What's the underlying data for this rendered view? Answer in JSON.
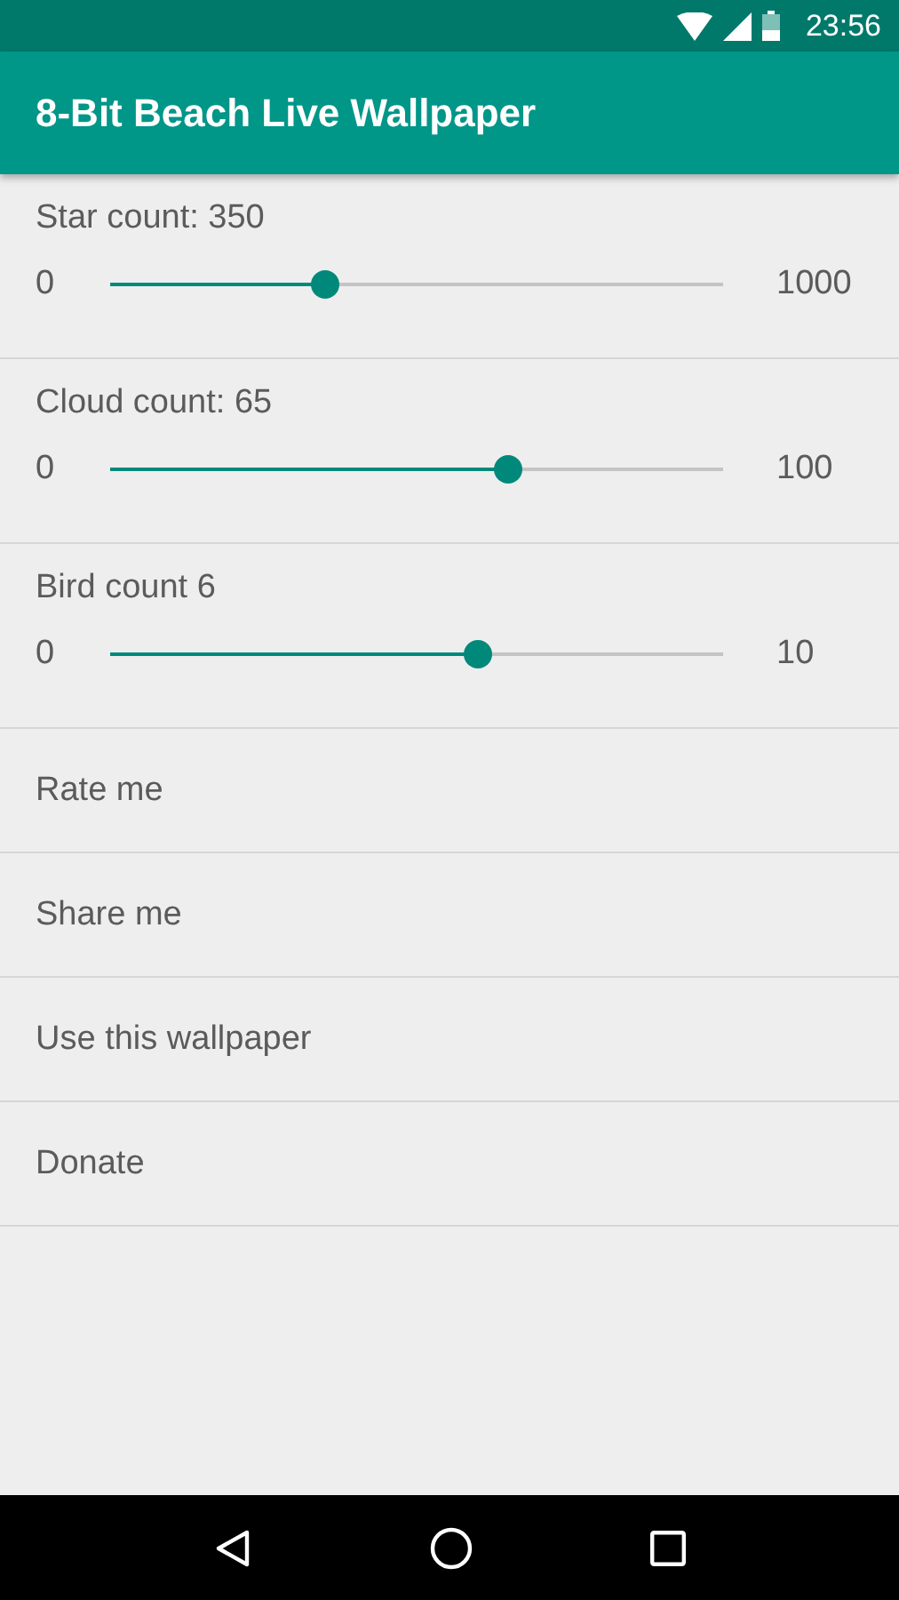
{
  "status_bar": {
    "time": "23:56"
  },
  "app_bar": {
    "title": "8-Bit Beach Live Wallpaper"
  },
  "sliders": [
    {
      "label": "Star count: 350",
      "min": "0",
      "max": "1000",
      "level": 0.35
    },
    {
      "label": "Cloud count: 65",
      "min": "0",
      "max": "100",
      "level": 0.65
    },
    {
      "label": "Bird count 6",
      "min": "0",
      "max": "10",
      "level": 0.6
    }
  ],
  "items": [
    {
      "label": "Rate me"
    },
    {
      "label": "Share me"
    },
    {
      "label": "Use this wallpaper"
    },
    {
      "label": "Donate"
    }
  ]
}
